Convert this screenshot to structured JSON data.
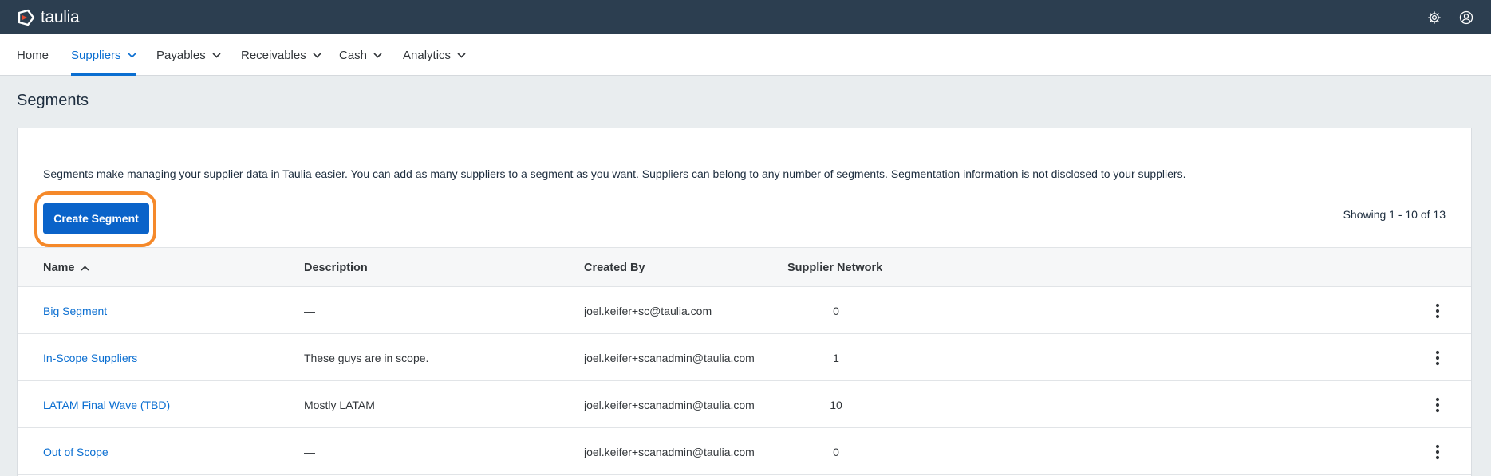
{
  "app": {
    "brand": "taulia"
  },
  "nav": {
    "items": [
      {
        "label": "Home"
      },
      {
        "label": "Suppliers"
      },
      {
        "label": "Payables"
      },
      {
        "label": "Receivables"
      },
      {
        "label": "Cash"
      },
      {
        "label": "Analytics"
      }
    ],
    "active": "Suppliers"
  },
  "page": {
    "title": "Segments",
    "intro": "Segments make managing your supplier data in Taulia easier. You can add as many suppliers to a segment as you want. Suppliers can belong to any number of segments. Segmentation information is not disclosed to your suppliers.",
    "create_button": "Create Segment",
    "showing": "Showing 1 - 10 of 13"
  },
  "table": {
    "columns": [
      "Name",
      "Description",
      "Created By",
      "Supplier Network"
    ],
    "sort_column": "Name",
    "sort_direction": "ascending",
    "rows": [
      {
        "name": "Big Segment",
        "description": "—",
        "created_by": "joel.keifer+sc@taulia.com",
        "supplier_network": "0"
      },
      {
        "name": "In-Scope Suppliers",
        "description": "These guys are in scope.",
        "created_by": "joel.keifer+scanadmin@taulia.com",
        "supplier_network": "1"
      },
      {
        "name": "LATAM Final Wave (TBD)",
        "description": "Mostly LATAM",
        "created_by": "joel.keifer+scanadmin@taulia.com",
        "supplier_network": "10"
      },
      {
        "name": "Out of Scope",
        "description": "—",
        "created_by": "joel.keifer+scanadmin@taulia.com",
        "supplier_network": "0"
      }
    ]
  },
  "icons": {
    "logo": "taulia-logo-icon",
    "settings": "gear-icon",
    "user": "user-circle-icon",
    "row_menu": "more-vertical-icon",
    "dropdown": "chevron-down-icon",
    "sort": "chevron-up-icon"
  },
  "colors": {
    "topbar": "#2c3e50",
    "accent": "#0a6ed1",
    "button": "#0a63c9",
    "highlight": "#f5892a",
    "logo_red": "#e8492f"
  }
}
